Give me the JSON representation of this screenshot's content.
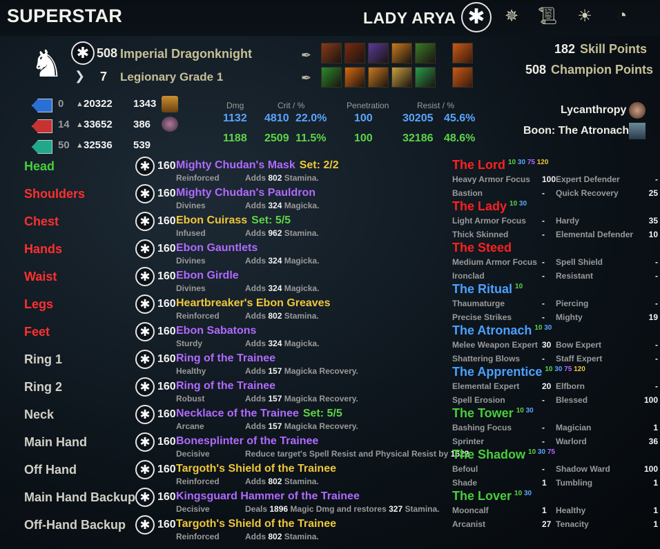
{
  "header": {
    "title": "SUPERSTAR",
    "character_name": "LADY ARYA",
    "nav_icons": [
      "champion-star-icon",
      "skills-compass-icon",
      "scroll-icon",
      "sun-icon",
      "alliance-icon"
    ]
  },
  "profile": {
    "level": "508",
    "race_class": "Imperial Dragonknight",
    "rank": "7",
    "rank_title": "Legionary Grade 1",
    "skill_points_value": "182",
    "skill_points_label": "Skill Points",
    "champion_points_value": "508",
    "champion_points_label": "Champion Points"
  },
  "skills": {
    "bar1_colors": [
      "#8a3a1a",
      "#7a2a10",
      "#5a3a9a",
      "#c87a20",
      "#3a7a2a"
    ],
    "bar1_ultimate_color": "#c85a1a",
    "bar2_colors": [
      "#2a8a2a",
      "#d86a10",
      "#c87a20",
      "#c8a040",
      "#2a9a4a"
    ],
    "bar2_ultimate_color": "#c85a1a"
  },
  "attributes": [
    {
      "points": "0",
      "value": "20322",
      "regen": "1343",
      "color": "#2a6fd6"
    },
    {
      "points": "14",
      "value": "33652",
      "regen": "386",
      "color": "#c83232"
    },
    {
      "points": "50",
      "value": "32536",
      "regen": "539",
      "color": "#1fa88a"
    }
  ],
  "combat": {
    "headers": {
      "dmg": "Dmg",
      "crit": "Crit / %",
      "pen": "Penetration",
      "resist": "Resist / %"
    },
    "spell": {
      "dmg": "1132",
      "crit": "4810",
      "crit_pct": "22.0%",
      "pen": "100",
      "resist": "30205",
      "resist_pct": "45.6%"
    },
    "weapon": {
      "dmg": "1188",
      "crit": "2509",
      "crit_pct": "11.5%",
      "pen": "100",
      "resist": "32186",
      "resist_pct": "48.6%"
    }
  },
  "status": {
    "vampirism": "Lycanthropy",
    "boon": "Boon: The Atronach"
  },
  "gear": [
    {
      "slot": "Head",
      "slot_color": "green",
      "level": "160",
      "name": "Mighty Chudan's Mask",
      "quality": "purple",
      "set": "Set: 2/2",
      "trait": "Reinforced",
      "ench_pre": "Adds ",
      "ench_val": "802",
      "ench_post": " Stamina."
    },
    {
      "slot": "Shoulders",
      "slot_color": "red",
      "level": "160",
      "name": "Mighty Chudan's Pauldron",
      "quality": "purple",
      "set": "",
      "trait": "Divines",
      "ench_pre": "Adds ",
      "ench_val": "324",
      "ench_post": " Magicka."
    },
    {
      "slot": "Chest",
      "slot_color": "red",
      "level": "160",
      "name": "Ebon Cuirass",
      "quality": "yellow",
      "set": "Set: 5/5",
      "set_color": "green",
      "trait": "Infused",
      "ench_pre": "Adds ",
      "ench_val": "962",
      "ench_post": " Stamina."
    },
    {
      "slot": "Hands",
      "slot_color": "red",
      "level": "160",
      "name": "Ebon Gauntlets",
      "quality": "purple",
      "set": "",
      "trait": "Divines",
      "ench_pre": "Adds ",
      "ench_val": "324",
      "ench_post": " Magicka."
    },
    {
      "slot": "Waist",
      "slot_color": "red",
      "level": "160",
      "name": "Ebon Girdle",
      "quality": "purple",
      "set": "",
      "trait": "Divines",
      "ench_pre": "Adds ",
      "ench_val": "324",
      "ench_post": " Magicka."
    },
    {
      "slot": "Legs",
      "slot_color": "red",
      "level": "160",
      "name": "Heartbreaker's Ebon Greaves",
      "quality": "yellow",
      "set": "",
      "trait": "Reinforced",
      "ench_pre": "Adds ",
      "ench_val": "802",
      "ench_post": " Stamina."
    },
    {
      "slot": "Feet",
      "slot_color": "red",
      "level": "160",
      "name": "Ebon Sabatons",
      "quality": "purple",
      "set": "",
      "trait": "Sturdy",
      "ench_pre": "Adds ",
      "ench_val": "324",
      "ench_post": " Magicka."
    },
    {
      "slot": "Ring 1",
      "slot_color": "grey",
      "level": "160",
      "name": "Ring of the Trainee",
      "quality": "purple",
      "set": "",
      "trait": "Healthy",
      "ench_pre": "Adds ",
      "ench_val": "157",
      "ench_post": " Magicka Recovery."
    },
    {
      "slot": "Ring 2",
      "slot_color": "grey",
      "level": "160",
      "name": "Ring of the Trainee",
      "quality": "purple",
      "set": "",
      "trait": "Robust",
      "ench_pre": "Adds ",
      "ench_val": "157",
      "ench_post": " Magicka Recovery."
    },
    {
      "slot": "Neck",
      "slot_color": "grey",
      "level": "160",
      "name": "Necklace of the Trainee",
      "quality": "purple",
      "set": "Set: 5/5",
      "set_color": "green",
      "trait": "Arcane",
      "ench_pre": "Adds ",
      "ench_val": "157",
      "ench_post": " Magicka Recovery."
    },
    {
      "slot": "Main Hand",
      "slot_color": "grey",
      "level": "160",
      "name": "Bonesplinter of the Trainee",
      "quality": "purple",
      "set": "",
      "trait": "Decisive",
      "ench_pre": "Reduce target's Spell Resist and Physical Resist by ",
      "ench_val": "1622",
      "ench_post": ""
    },
    {
      "slot": "Off Hand",
      "slot_color": "grey",
      "level": "160",
      "name": "Targoth's Shield of the Trainee",
      "quality": "yellow",
      "set": "",
      "trait": "Reinforced",
      "ench_pre": "Adds ",
      "ench_val": "802",
      "ench_post": " Stamina."
    },
    {
      "slot": "Main Hand Backup",
      "slot_color": "grey",
      "level": "160",
      "name": "Kingsguard Hammer of the Trainee",
      "quality": "purple",
      "set": "",
      "trait": "Decisive",
      "ench_pre": "Deals ",
      "ench_val": "1896",
      "ench_post": " Magic Dmg and restores ",
      "ench_val2": "327",
      "ench_post2": " Stamina."
    },
    {
      "slot": "Off-Hand Backup",
      "slot_color": "grey",
      "level": "160",
      "name": "Targoth's Shield of the Trainee",
      "quality": "yellow",
      "set": "",
      "trait": "Reinforced",
      "ench_pre": "Adds ",
      "ench_val": "802",
      "ench_post": " Stamina."
    }
  ],
  "constellations": [
    {
      "name": "The Lord",
      "color": "red",
      "tags": [
        "10",
        "30",
        "75",
        "120"
      ],
      "rows": [
        {
          "n1": "Heavy Armor Focus",
          "v1": "100",
          "n2": "Expert Defender",
          "v2": "-"
        },
        {
          "n1": "Bastion",
          "v1": "-",
          "n2": "Quick Recovery",
          "v2": "25"
        }
      ]
    },
    {
      "name": "The Lady",
      "color": "red",
      "tags": [
        "10",
        "30"
      ],
      "rows": [
        {
          "n1": "Light Armor Focus",
          "v1": "-",
          "n2": "Hardy",
          "v2": "35"
        },
        {
          "n1": "Thick Skinned",
          "v1": "-",
          "n2": "Elemental Defender",
          "v2": "10"
        }
      ]
    },
    {
      "name": "The Steed",
      "color": "red",
      "tags": [],
      "rows": [
        {
          "n1": "Medium Armor Focus",
          "v1": "-",
          "n2": "Spell Shield",
          "v2": "-"
        },
        {
          "n1": "Ironclad",
          "v1": "-",
          "n2": "Resistant",
          "v2": "-"
        }
      ]
    },
    {
      "name": "The Ritual",
      "color": "blue",
      "tags": [
        "10"
      ],
      "rows": [
        {
          "n1": "Thaumaturge",
          "v1": "-",
          "n2": "Piercing",
          "v2": "-"
        },
        {
          "n1": "Precise Strikes",
          "v1": "-",
          "n2": "Mighty",
          "v2": "19"
        }
      ]
    },
    {
      "name": "The Atronach",
      "color": "blue",
      "tags": [
        "10",
        "30"
      ],
      "rows": [
        {
          "n1": "Melee Weapon Expert",
          "v1": "30",
          "n2": "Bow Expert",
          "v2": "-"
        },
        {
          "n1": "Shattering Blows",
          "v1": "-",
          "n2": "Staff Expert",
          "v2": "-"
        }
      ]
    },
    {
      "name": "The Apprentice",
      "color": "blue",
      "tags": [
        "10",
        "30",
        "75",
        "120"
      ],
      "rows": [
        {
          "n1": "Elemental Expert",
          "v1": "20",
          "n2": "Elfborn",
          "v2": "-"
        },
        {
          "n1": "Spell Erosion",
          "v1": "-",
          "n2": "Blessed",
          "v2": "100"
        }
      ]
    },
    {
      "name": "The Tower",
      "color": "green",
      "tags": [
        "10",
        "30"
      ],
      "rows": [
        {
          "n1": "Bashing Focus",
          "v1": "-",
          "n2": "Magician",
          "v2": "1"
        },
        {
          "n1": "Sprinter",
          "v1": "-",
          "n2": "Warlord",
          "v2": "36"
        }
      ]
    },
    {
      "name": "The Shadow",
      "color": "green",
      "tags": [
        "10",
        "30",
        "75"
      ],
      "rows": [
        {
          "n1": "Befoul",
          "v1": "-",
          "n2": "Shadow Ward",
          "v2": "100"
        },
        {
          "n1": "Shade",
          "v1": "1",
          "n2": "Tumbling",
          "v2": "1"
        }
      ]
    },
    {
      "name": "The Lover",
      "color": "green",
      "tags": [
        "10",
        "30"
      ],
      "rows": [
        {
          "n1": "Mooncalf",
          "v1": "1",
          "n2": "Healthy",
          "v2": "1"
        },
        {
          "n1": "Arcanist",
          "v1": "27",
          "n2": "Tenacity",
          "v2": "1"
        }
      ]
    }
  ]
}
